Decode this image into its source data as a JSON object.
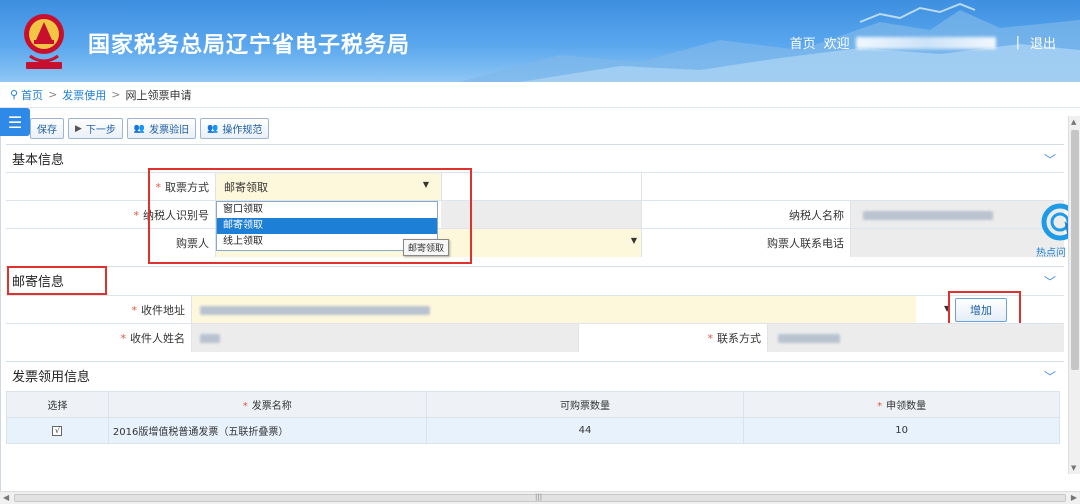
{
  "header": {
    "site_title": "国家税务总局辽宁省电子税务局",
    "nav_home": "首页",
    "nav_welcome": "欢迎",
    "nav_separator": "|",
    "nav_logout": "退出"
  },
  "breadcrumb": {
    "items": [
      "首页",
      "发票使用",
      "网上领票申请"
    ],
    "separator": ">"
  },
  "toolbar": {
    "save": "保存",
    "next_step": "下一步",
    "invoice_verify": "发票验旧",
    "operation_guide": "操作规范"
  },
  "sections": {
    "basic_info": "基本信息",
    "mail_info": "邮寄信息",
    "invoice_info": "发票领用信息"
  },
  "basic": {
    "pickup_method_label": "取票方式",
    "pickup_method_value": "邮寄领取",
    "taxpayer_id_label": "纳税人识别号",
    "taxpayer_name_label": "纳税人名称",
    "buyer_label": "购票人",
    "buyer_phone_label": "购票人联系电话"
  },
  "dropdown": {
    "options": [
      "窗口领取",
      "邮寄领取",
      "线上领取"
    ],
    "selected_index": 1,
    "tooltip": "邮寄领取"
  },
  "mail": {
    "address_label": "收件地址",
    "recipient_label": "收件人姓名",
    "contact_label": "联系方式",
    "add_button": "增加"
  },
  "table": {
    "headers": [
      "选择",
      "发票名称",
      "可购票数量",
      "申领数量"
    ],
    "required_cols": [
      1,
      3
    ],
    "rows": [
      {
        "checked": true,
        "check_mark": "√",
        "name": "2016版增值税普通发票（五联折叠票）",
        "available": "44",
        "apply": "10"
      }
    ]
  },
  "hot_questions": {
    "label": "热点问"
  },
  "scrollbar": {
    "up": "▲",
    "down": "▼",
    "left": "◀",
    "right": "▶",
    "grip": "|||"
  },
  "colors": {
    "accent": "#1e7fd6",
    "required": "#e0573f",
    "highlight_box": "#e0322c",
    "selected_option": "#1e7fd6"
  }
}
